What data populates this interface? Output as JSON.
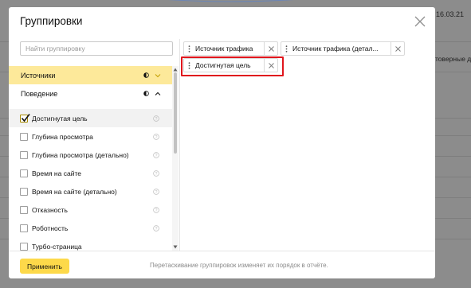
{
  "background": {
    "date_fragment": "16.03.21",
    "text_fragment": "товерные д"
  },
  "modal": {
    "title": "Группировки",
    "search": {
      "placeholder": "Найти группировку",
      "value": ""
    },
    "groups": [
      {
        "label": "Источники",
        "active": true,
        "expanded": false
      },
      {
        "label": "Поведение",
        "active": false,
        "expanded": true
      }
    ],
    "items": [
      {
        "label": "Достигнутая цель",
        "checked": true
      },
      {
        "label": "Глубина просмотра",
        "checked": false
      },
      {
        "label": "Глубина просмотра (детально)",
        "checked": false
      },
      {
        "label": "Время на сайте",
        "checked": false
      },
      {
        "label": "Время на сайте (детально)",
        "checked": false
      },
      {
        "label": "Отказность",
        "checked": false
      },
      {
        "label": "Роботность",
        "checked": false
      },
      {
        "label": "Турбо-страница",
        "checked": false
      }
    ],
    "selected_chips": [
      {
        "label": "Источник трафика"
      },
      {
        "label": "Источник трафика (детально)",
        "display": "Источник трафика (детал..."
      },
      {
        "label": "Достигнутая цель"
      }
    ],
    "apply_label": "Применить",
    "hint": "Перетаскивание группировок изменяет их порядок в отчёте."
  },
  "colors": {
    "accent_yellow": "#fdd94a",
    "active_group": "#fde99a",
    "highlight_red": "#e0161d"
  }
}
